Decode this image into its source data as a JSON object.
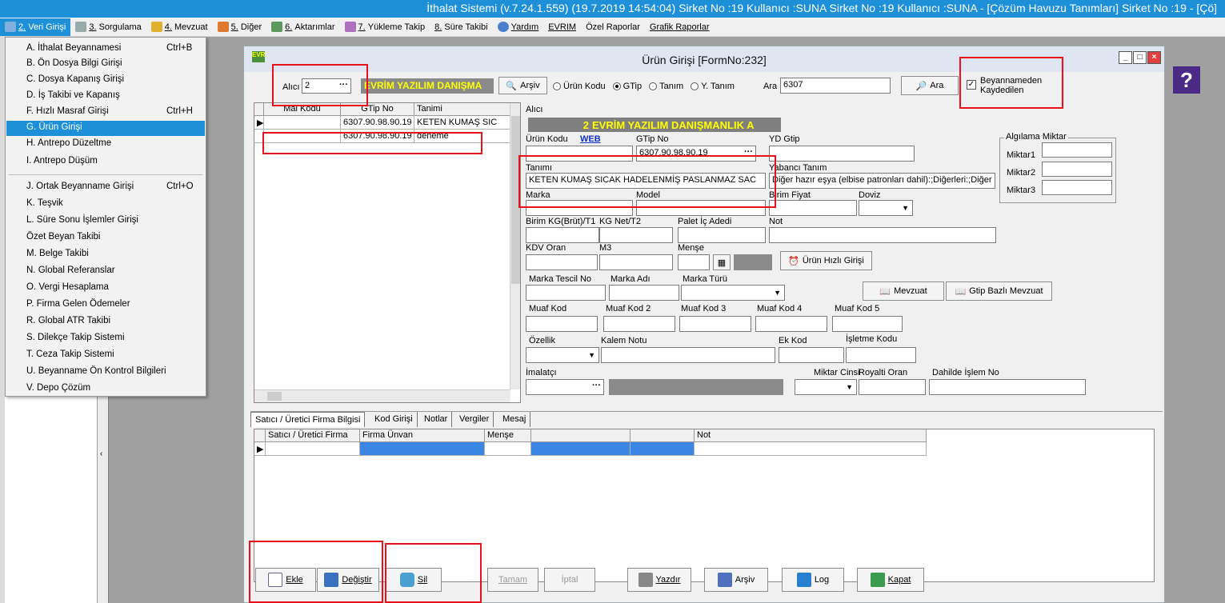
{
  "app": {
    "title": "İthalat Sistemi (v.7.24.1.559) (19.7.2019 14:54:04) Sirket No :19 Kullanıcı :SUNA Sirket No :19 Kullanıcı :SUNA - [Çözüm Havuzu Tanımları] Sirket No :19 - [Çö]"
  },
  "menubar": {
    "items": [
      {
        "num": "2.",
        "label": "Veri Girişi"
      },
      {
        "num": "3.",
        "label": "Sorgulama"
      },
      {
        "num": "4.",
        "label": "Mevzuat"
      },
      {
        "num": "5.",
        "label": "Diğer"
      },
      {
        "num": "6.",
        "label": "Aktarımlar"
      },
      {
        "num": "7.",
        "label": "Yükleme Takip"
      },
      {
        "num": "8.",
        "label": "Süre Takibi"
      },
      {
        "num": "",
        "label": "Yardım"
      },
      {
        "num": "",
        "label": "EVRIM"
      },
      {
        "num": "",
        "label": "Özel Raporlar"
      },
      {
        "num": "",
        "label": "Grafik Raporlar"
      }
    ]
  },
  "dropdown": {
    "items": [
      {
        "label": "A.  İthalat Beyannamesi",
        "shortcut": "Ctrl+B"
      },
      {
        "label": "B.  Ön Dosya Bilgi Girişi",
        "shortcut": ""
      },
      {
        "label": "C.  Dosya Kapanış Girişi",
        "shortcut": ""
      },
      {
        "label": "D.  İş Takibi ve Kapanış",
        "shortcut": ""
      },
      {
        "label": "F.  Hızlı Masraf Girişi",
        "shortcut": "Ctrl+H"
      },
      {
        "label": "G.  Ürün Girişi",
        "shortcut": ""
      },
      {
        "label": "H.  Antrepo Düzeltme",
        "shortcut": ""
      },
      {
        "label": "I.   Antrepo Düşüm",
        "shortcut": ""
      },
      {
        "label": "J.  Ortak Beyanname Girişi",
        "shortcut": "Ctrl+O"
      },
      {
        "label": "K.  Teşvik",
        "shortcut": ""
      },
      {
        "label": "L.  Süre Sonu İşlemler Girişi",
        "shortcut": ""
      },
      {
        "label": "     Özet Beyan Takibi",
        "shortcut": ""
      },
      {
        "label": "M.  Belge Takibi",
        "shortcut": ""
      },
      {
        "label": "N.  Global Referanslar",
        "shortcut": ""
      },
      {
        "label": "O.  Vergi Hesaplama",
        "shortcut": ""
      },
      {
        "label": "P.  Firma Gelen Ödemeler",
        "shortcut": ""
      },
      {
        "label": "R.  Global ATR Takibi",
        "shortcut": ""
      },
      {
        "label": "S.  Dilekçe Takip Sistemi",
        "shortcut": ""
      },
      {
        "label": "T.  Ceza Takip Sistemi",
        "shortcut": ""
      },
      {
        "label": "U.  Beyanname Ön Kontrol Bilgileri",
        "shortcut": ""
      },
      {
        "label": "V.  Depo Çözüm",
        "shortcut": ""
      }
    ]
  },
  "window": {
    "title": "Ürün Girişi [FormNo:232]",
    "min": "_",
    "max": "□",
    "close": "×"
  },
  "toolbar": {
    "alici_label": "Alıcı",
    "alici_value": "2",
    "firm_short": "EVRİM YAZILIM DANIŞMA",
    "arsiv": "Arşiv",
    "radio_urun_kodu": "Ürün Kodu",
    "radio_gtip": "GTip",
    "radio_tanim": "Tanım",
    "radio_y_tanim": "Y. Tanım",
    "ara_label": "Ara",
    "ara_value": "6307",
    "ara_button": "Ara",
    "beyanname_check": "Beyannameden Kaydedilen"
  },
  "left_grid": {
    "headers": [
      "Mal Kodu",
      "GTip No",
      "Tanimi"
    ],
    "rows": [
      [
        "",
        "6307.90.98.90.19",
        "KETEN KUMAŞ SIC"
      ],
      [
        "",
        "6307.90.98.90.19",
        "deneme"
      ]
    ]
  },
  "form": {
    "alici_label": "Alıcı",
    "alici_no": "2",
    "alici_name": "EVRİM YAZILIM DANIŞMANLIK A",
    "urun_kodu": "Ürün Kodu",
    "web": "WEB",
    "gtip_no": "GTip No",
    "gtip_value": "6307.90.98.90.19",
    "yd_gtip": "YD Gtip",
    "tanimi": "Tanımı",
    "tanimi_value": "KETEN KUMAŞ SICAK HADELENMİŞ PASLANMAZ SAC",
    "yabanci_tanim": "Yabancı Tanım",
    "yabanci_value": "Diğer hazır eşya (elbise patronları dahil):;Diğerleri:;Diğer",
    "marka": "Marka",
    "model": "Model",
    "birim_fiyat": "Birim Fiyat",
    "doviz": "Doviz",
    "birim_kg": "Birim KG(Brüt)/T1",
    "kg_net": "KG Net/T2",
    "palet": "Palet İç Adedi",
    "not": "Not",
    "kdv": "KDV Oran",
    "m3": "M3",
    "mense": "Menşe",
    "urun_hizli": "Ürün Hızlı Girişi",
    "marka_tescil": "Marka Tescil No",
    "marka_adi": "Marka Adı",
    "marka_turu": "Marka Türü",
    "mevzuat": "Mevzuat",
    "gtip_bazli": "Gtip Bazlı Mevzuat",
    "muaf1": "Muaf Kod",
    "muaf2": "Muaf Kod 2",
    "muaf3": "Muaf Kod 3",
    "muaf4": "Muaf Kod 4",
    "muaf5": "Muaf Kod 5",
    "ozellik": "Özellik",
    "kalem_notu": "Kalem Notu",
    "ek_kod": "Ek Kod",
    "isletme_kodu": "İşletme Kodu",
    "imalatci": "İmalatçı",
    "miktar_cinsi": "Miktar Cinsi",
    "royalti": "Royalti Oran",
    "dahilde": "Dahilde İşlem No",
    "algilama": "Algılama Miktar",
    "miktar1": "Miktar1",
    "miktar2": "Miktar2",
    "miktar3": "Miktar3"
  },
  "tabs": [
    "Satıcı / Üretici Firma Bilgisi",
    "Kod Girişi",
    "Notlar",
    "Vergiler",
    "Mesaj"
  ],
  "bottom_grid": {
    "headers": [
      "Satıcı / Üretici Firma",
      "Firma Ünvan",
      "Menşe",
      "",
      "",
      "Not"
    ]
  },
  "buttons": {
    "ekle": "Ekle",
    "degistir": "Değiştir",
    "sil": "Sil",
    "tamam": "Tamam",
    "iptal": "İptal",
    "yazdir": "Yazdır",
    "arsiv": "Arşiv",
    "log": "Log",
    "kapat": "Kapat"
  },
  "colors": {
    "accent": "#1e90d8",
    "highlight": "#e8101a",
    "firm_text": "#ffff00"
  }
}
